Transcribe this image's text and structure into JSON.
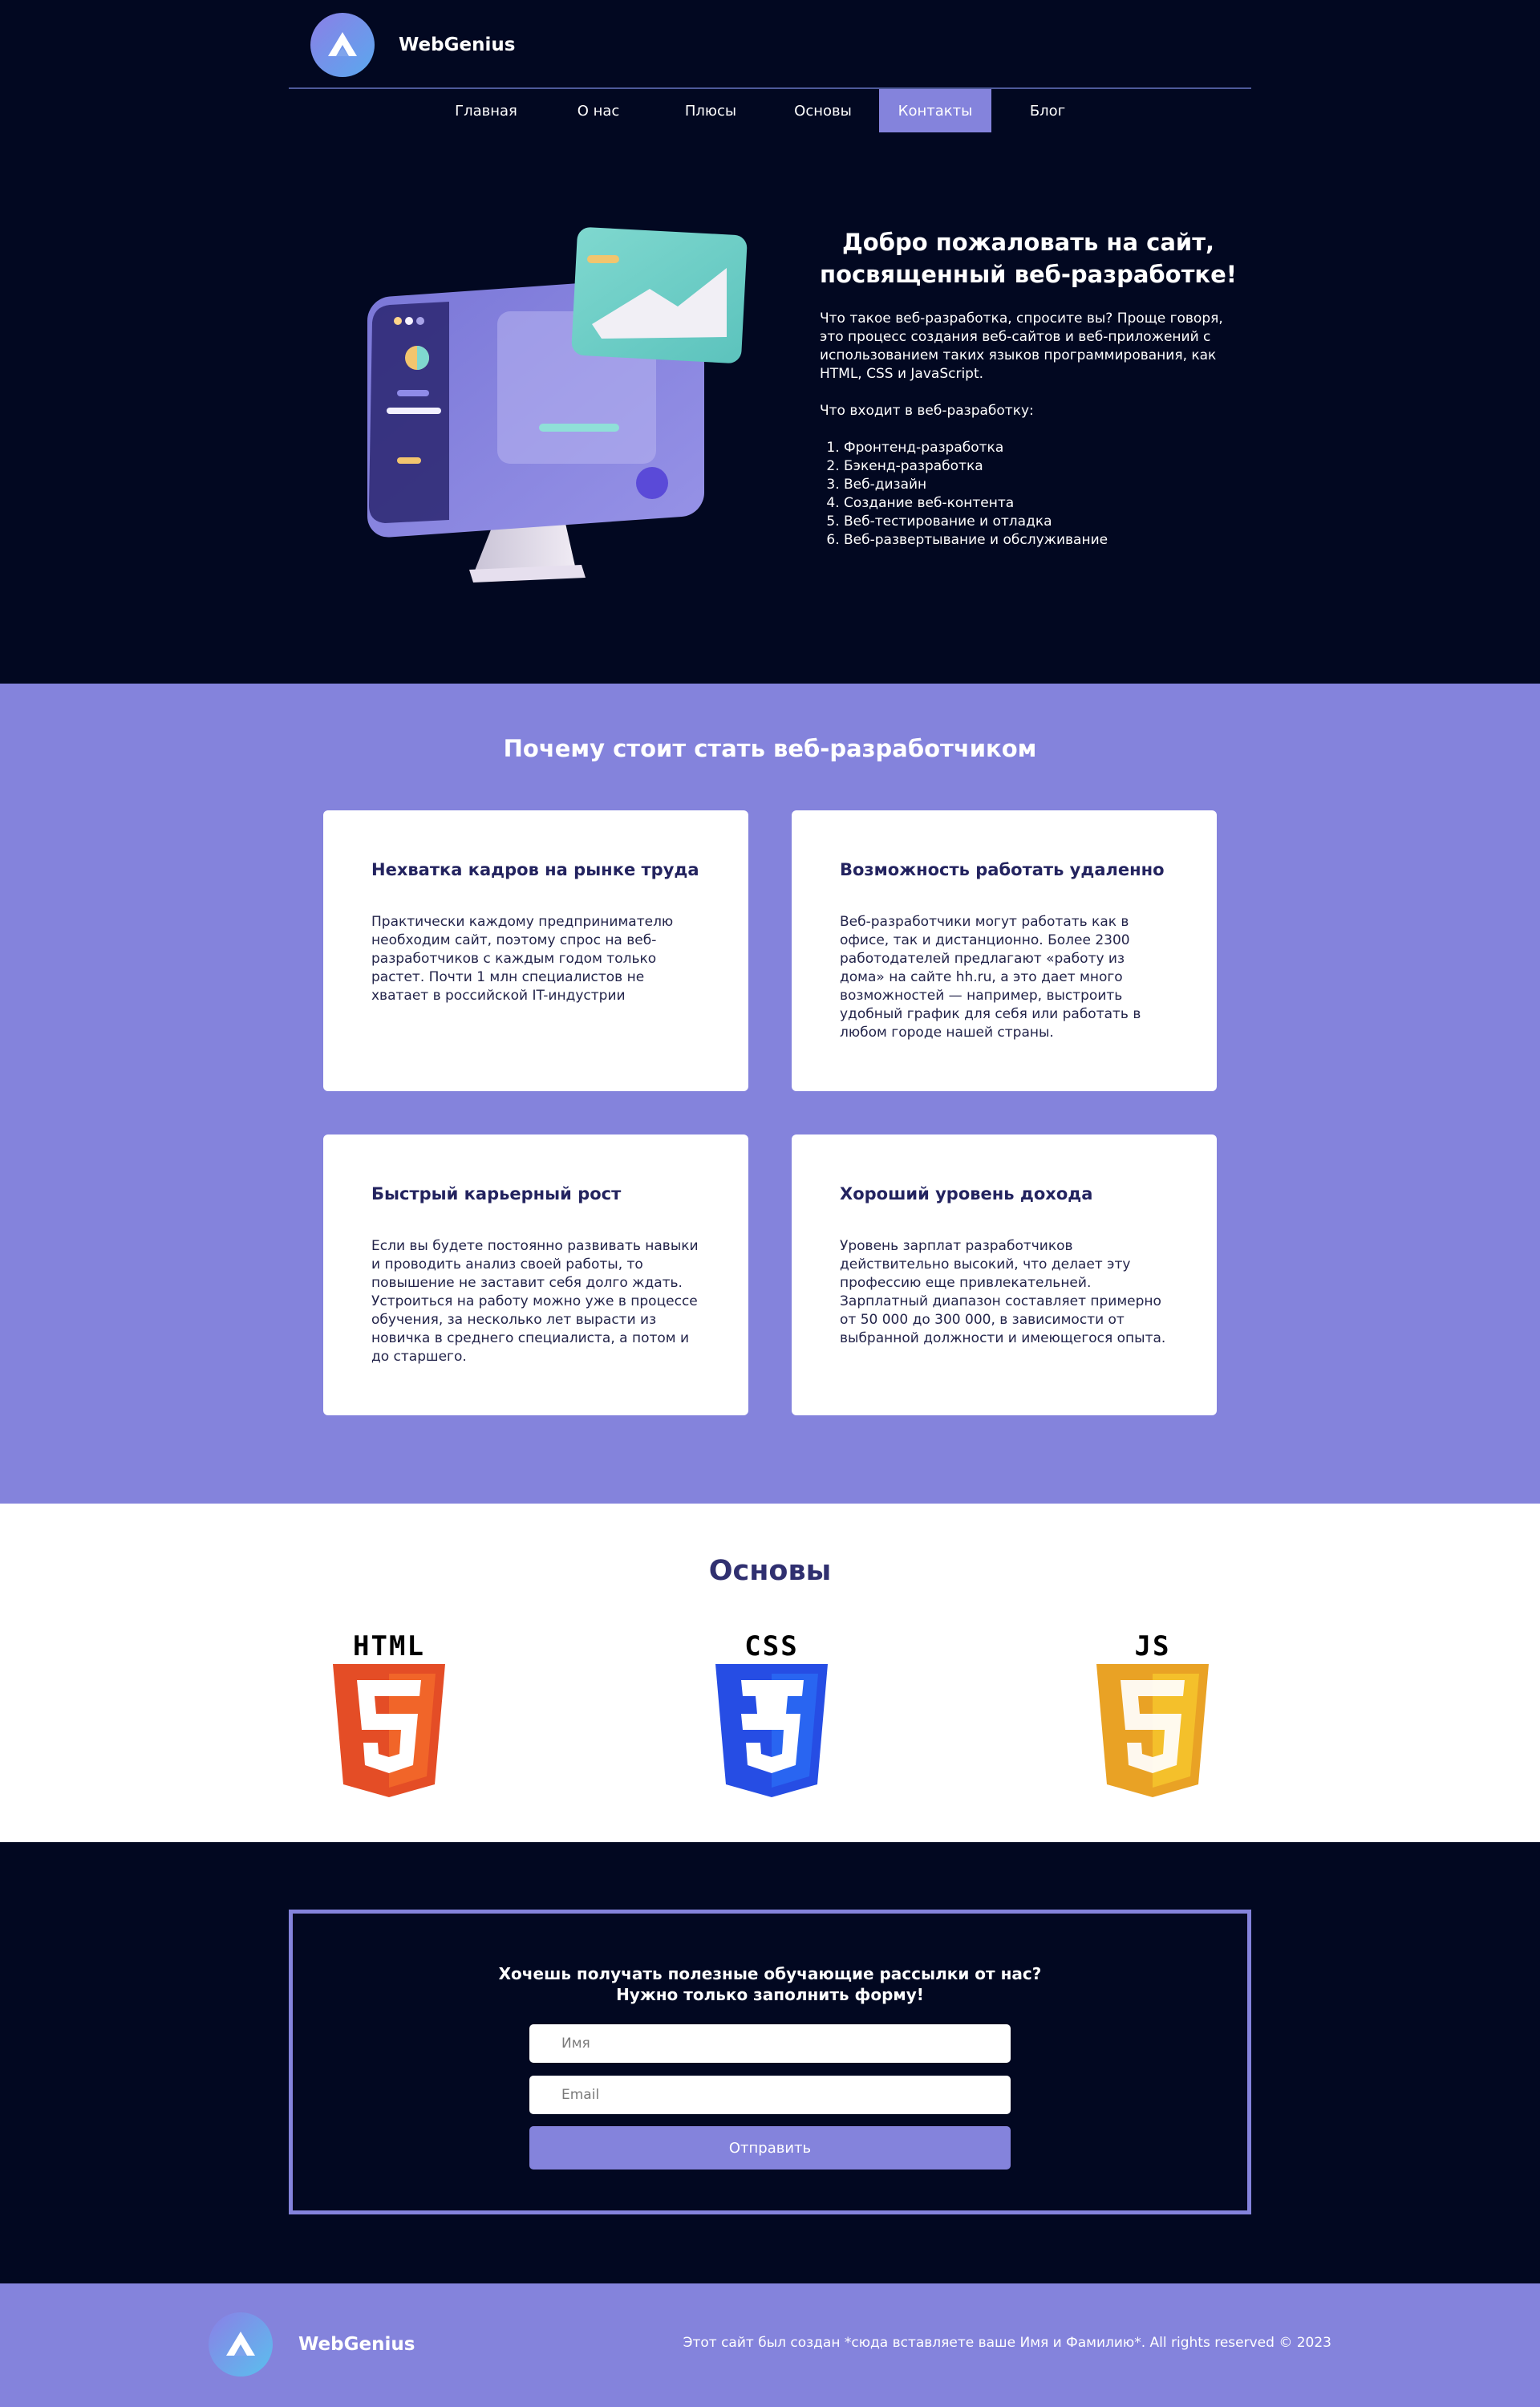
{
  "header": {
    "brand": "WebGenius",
    "nav": [
      {
        "label": "Главная",
        "active": false
      },
      {
        "label": "О нас",
        "active": false
      },
      {
        "label": "Плюсы",
        "active": false
      },
      {
        "label": "Основы",
        "active": false
      },
      {
        "label": "Контакты",
        "active": true
      },
      {
        "label": "Блог",
        "active": false
      }
    ]
  },
  "hero": {
    "title_line1": "Добро пожаловать на сайт,",
    "title_line2": "посвященный веб-разработке!",
    "paragraph1": "Что такое веб-разработка, спросите вы? Проще говоря, это процесс создания веб-сайтов и веб-приложений с использованием таких языков программирования, как HTML, CSS и JavaScript.",
    "paragraph2": "Что входит в веб-разработку:",
    "list": [
      "Фронтенд-разработка",
      "Бэкенд-разработка",
      "Веб-дизайн",
      "Создание веб-контента",
      "Веб-тестирование и отладка",
      "Веб-развертывание и обслуживание"
    ]
  },
  "why": {
    "title": "Почему стоит стать веб-разработчиком",
    "cards": [
      {
        "title": "Нехватка кадров на рынке труда",
        "text": "Практически каждому предпринимателю необходим сайт, поэтому спрос на веб-разработчиков с каждым годом только растет. Почти 1 млн специалистов не хватает в российской IT-индустрии"
      },
      {
        "title": "Возможность работать удаленно",
        "text": "Веб-разработчики могут работать как в офисе, так и дистанционно. Более 2300 работодателей предлагают «работу из дома» на сайте hh.ru, а это дает много возможностей — например, выстроить удобный график для себя или работать в любом городе нашей страны."
      },
      {
        "title": "Быстрый карьерный рост",
        "text": "Если вы будете постоянно развивать навыки и проводить анализ своей работы, то повышение не заставит себя долго ждать. Устроиться на работу можно уже в процессе обучения, за несколько лет вырасти из новичка в среднего специалиста, а потом и до старшего."
      },
      {
        "title": "Хороший уровень дохода",
        "text": "Уровень зарплат разработчиков действительно высокий, что делает эту профессию еще привлекательней. Зарплатный диапазон составляет примерно от 50 000 до 300 000, в зависимости от выбранной должности и имеющегося опыта."
      }
    ]
  },
  "basics": {
    "title": "Основы",
    "items": [
      {
        "label": "HTML",
        "digit": "5",
        "icon": "html5-icon",
        "color": "#e44d26",
        "color_light": "#f16529"
      },
      {
        "label": "CSS",
        "digit": "3",
        "icon": "css3-icon",
        "color": "#264de4",
        "color_light": "#2965f1"
      },
      {
        "label": "JS",
        "digit": "5",
        "icon": "js-icon",
        "color": "#e9a225",
        "color_light": "#f4c02b"
      }
    ]
  },
  "subscribe": {
    "title_line1": "Хочешь получать полезные обучающие рассылки от нас?",
    "title_line2": "Нужно только заполнить форму!",
    "name_placeholder": "Имя",
    "email_placeholder": "Email",
    "button": "Отправить"
  },
  "footer": {
    "brand": "WebGenius",
    "copyright": "Этот сайт был создан *сюда вставляете ваше Имя и Фамилию*. All rights reserved © 2023"
  },
  "colors": {
    "dark_bg": "#020821",
    "accent": "#8483dc",
    "card_title": "#23235f"
  }
}
